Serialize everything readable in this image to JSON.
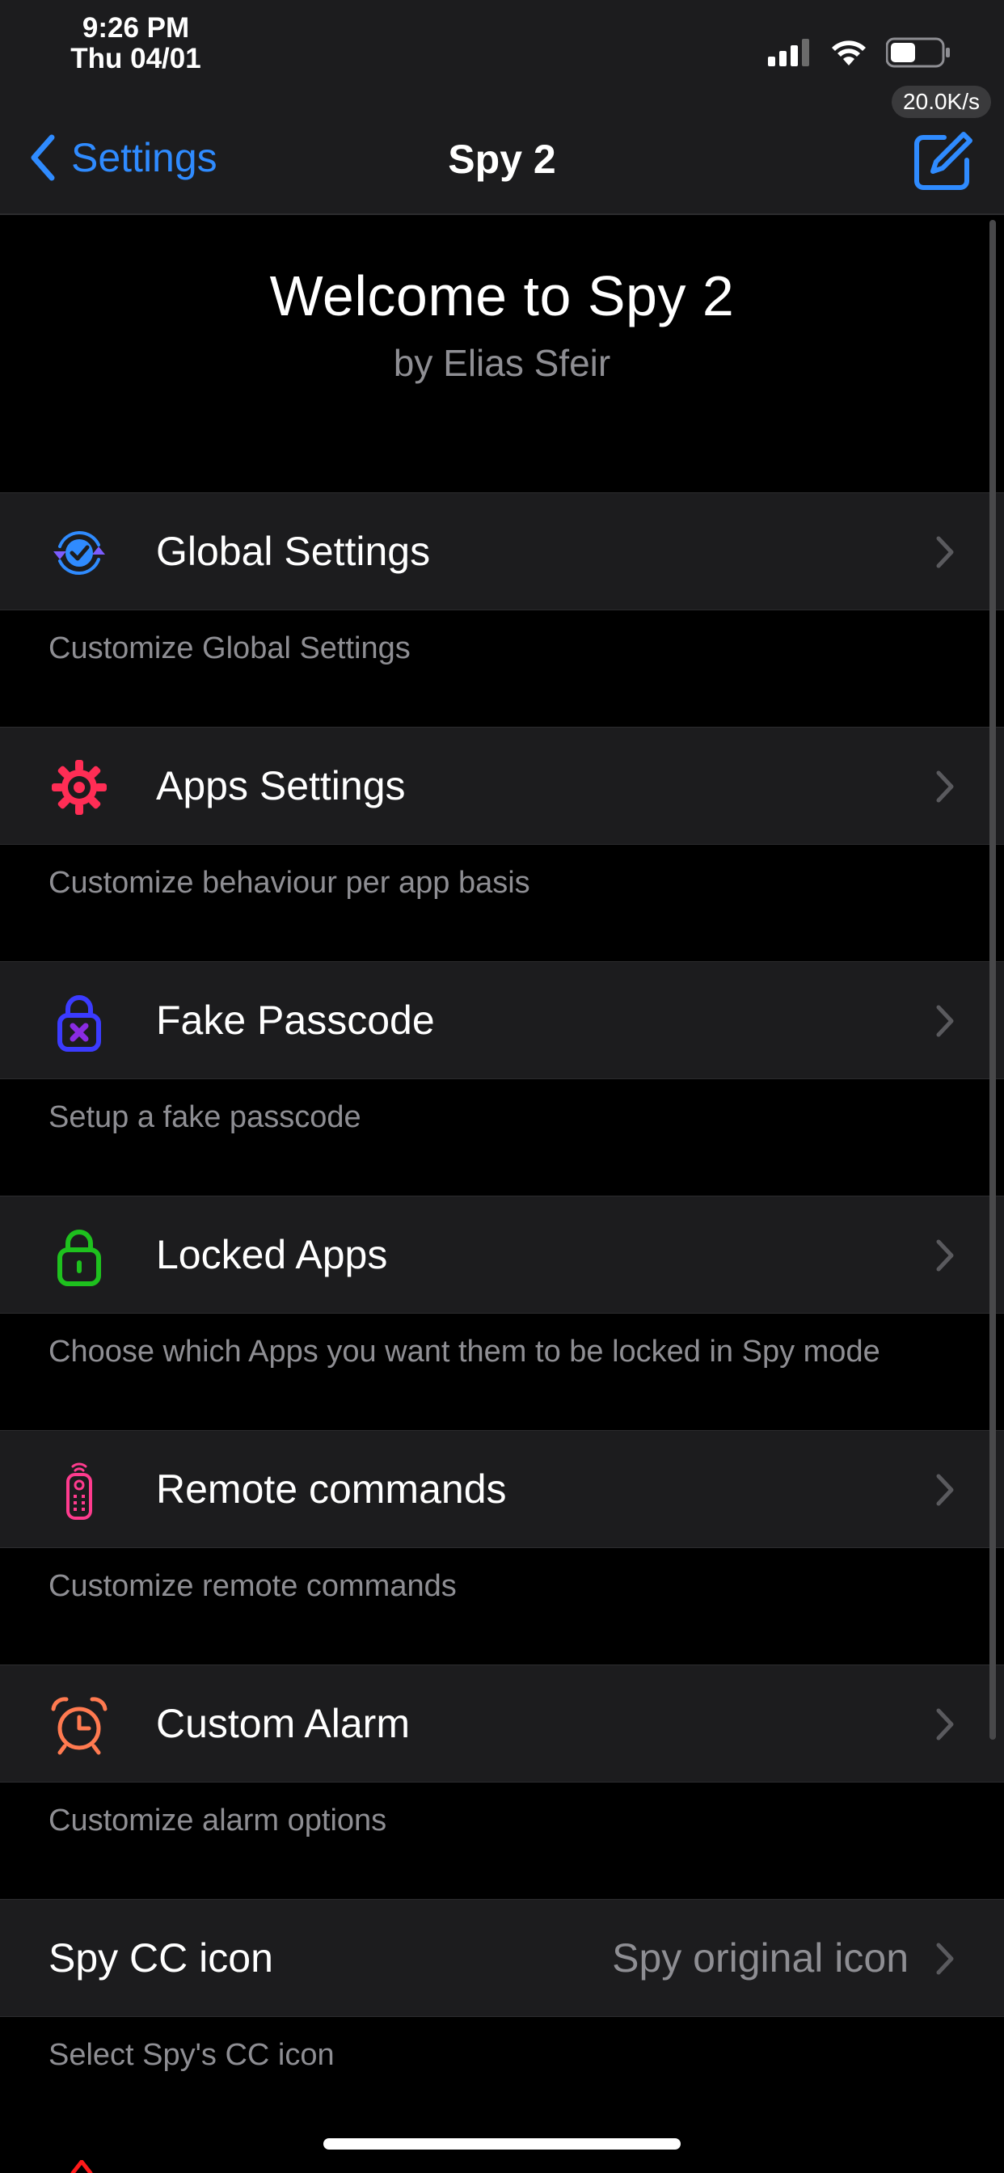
{
  "status_bar": {
    "time": "9:26 PM",
    "date": "Thu 04/01",
    "speed": "20.0K/s"
  },
  "nav": {
    "back_label": "Settings",
    "title": "Spy 2"
  },
  "welcome": {
    "title": "Welcome to Spy 2",
    "subtitle": "by Elias Sfeir"
  },
  "sections": [
    {
      "label": "Global Settings",
      "footer": "Customize Global Settings",
      "icon": "sync-check-icon",
      "color": "#2f8bff"
    },
    {
      "label": "Apps Settings",
      "footer": "Customize behaviour per app basis",
      "icon": "gear-icon",
      "color": "#ff2d55"
    },
    {
      "label": "Fake Passcode",
      "footer": "Setup a fake passcode",
      "icon": "lock-x-icon",
      "color": "#3b3bff"
    },
    {
      "label": "Locked Apps",
      "footer": "Choose which Apps you want them to be locked in Spy mode",
      "icon": "lock-icon",
      "color": "#1ec11e"
    },
    {
      "label": "Remote commands",
      "footer": "Customize remote commands",
      "icon": "remote-icon",
      "color": "#ff3b8e"
    },
    {
      "label": "Custom Alarm",
      "footer": "Customize alarm options",
      "icon": "alarm-clock-icon",
      "color": "#ff7a50"
    }
  ],
  "cc_icon": {
    "label": "Spy CC icon",
    "value": "Spy original icon",
    "footer": "Select Spy's CC icon"
  },
  "colors": {
    "accent": "#2f8bff",
    "background": "#000000",
    "cell": "#1c1c1e",
    "secondary_text": "#8e8e93"
  }
}
